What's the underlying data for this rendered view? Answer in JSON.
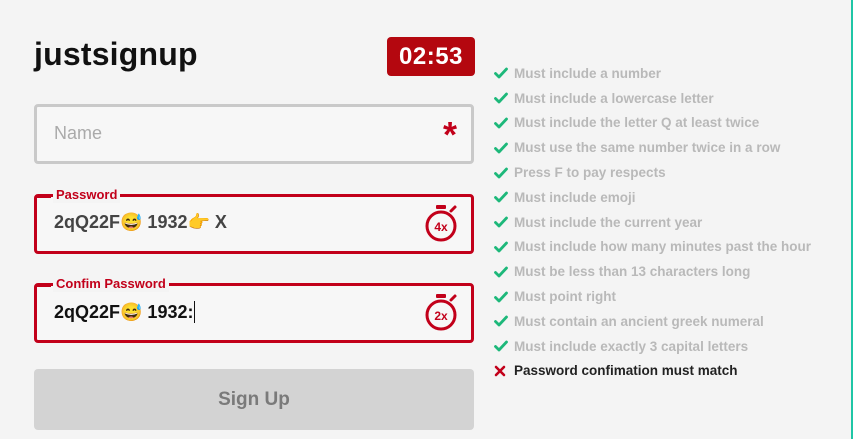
{
  "app": {
    "title": "justsignup",
    "timer": "02:53"
  },
  "form": {
    "name": {
      "placeholder": "Name",
      "required_mark": "*"
    },
    "password": {
      "label": "Password",
      "value": "2qQ22F😅 1932👉 X",
      "multiplier": "4x"
    },
    "confirm": {
      "label": "Confim Password",
      "value": "2qQ22F😅 1932:",
      "multiplier": "2x"
    },
    "submit_label": "Sign Up"
  },
  "rules": [
    {
      "text": "Must include a number",
      "status": "pass"
    },
    {
      "text": "Must include a lowercase letter",
      "status": "pass"
    },
    {
      "text": "Must include the letter Q at least twice",
      "status": "pass"
    },
    {
      "text": "Must use the same number twice in a row",
      "status": "pass"
    },
    {
      "text": "Press F to pay respects",
      "status": "pass"
    },
    {
      "text": "Must include emoji",
      "status": "pass"
    },
    {
      "text": "Must include the current year",
      "status": "pass"
    },
    {
      "text": "Must include how many minutes past the hour",
      "status": "pass"
    },
    {
      "text": "Must be less than 13 characters long",
      "status": "pass"
    },
    {
      "text": "Must point right",
      "status": "pass"
    },
    {
      "text": "Must contain an ancient greek numeral",
      "status": "pass"
    },
    {
      "text": "Must include exactly 3 capital letters",
      "status": "pass"
    },
    {
      "text": "Password confimation must match",
      "status": "fail"
    }
  ],
  "icons": {
    "pass": "check-icon",
    "fail": "cross-icon",
    "timer_badge": "stopwatch-icon"
  },
  "colors": {
    "accent": "#c2001a",
    "timer_bg": "#b4070f",
    "check": "#1db87a",
    "rule_text": "#b9b9b9",
    "teal_edge": "#1fc6a6"
  }
}
